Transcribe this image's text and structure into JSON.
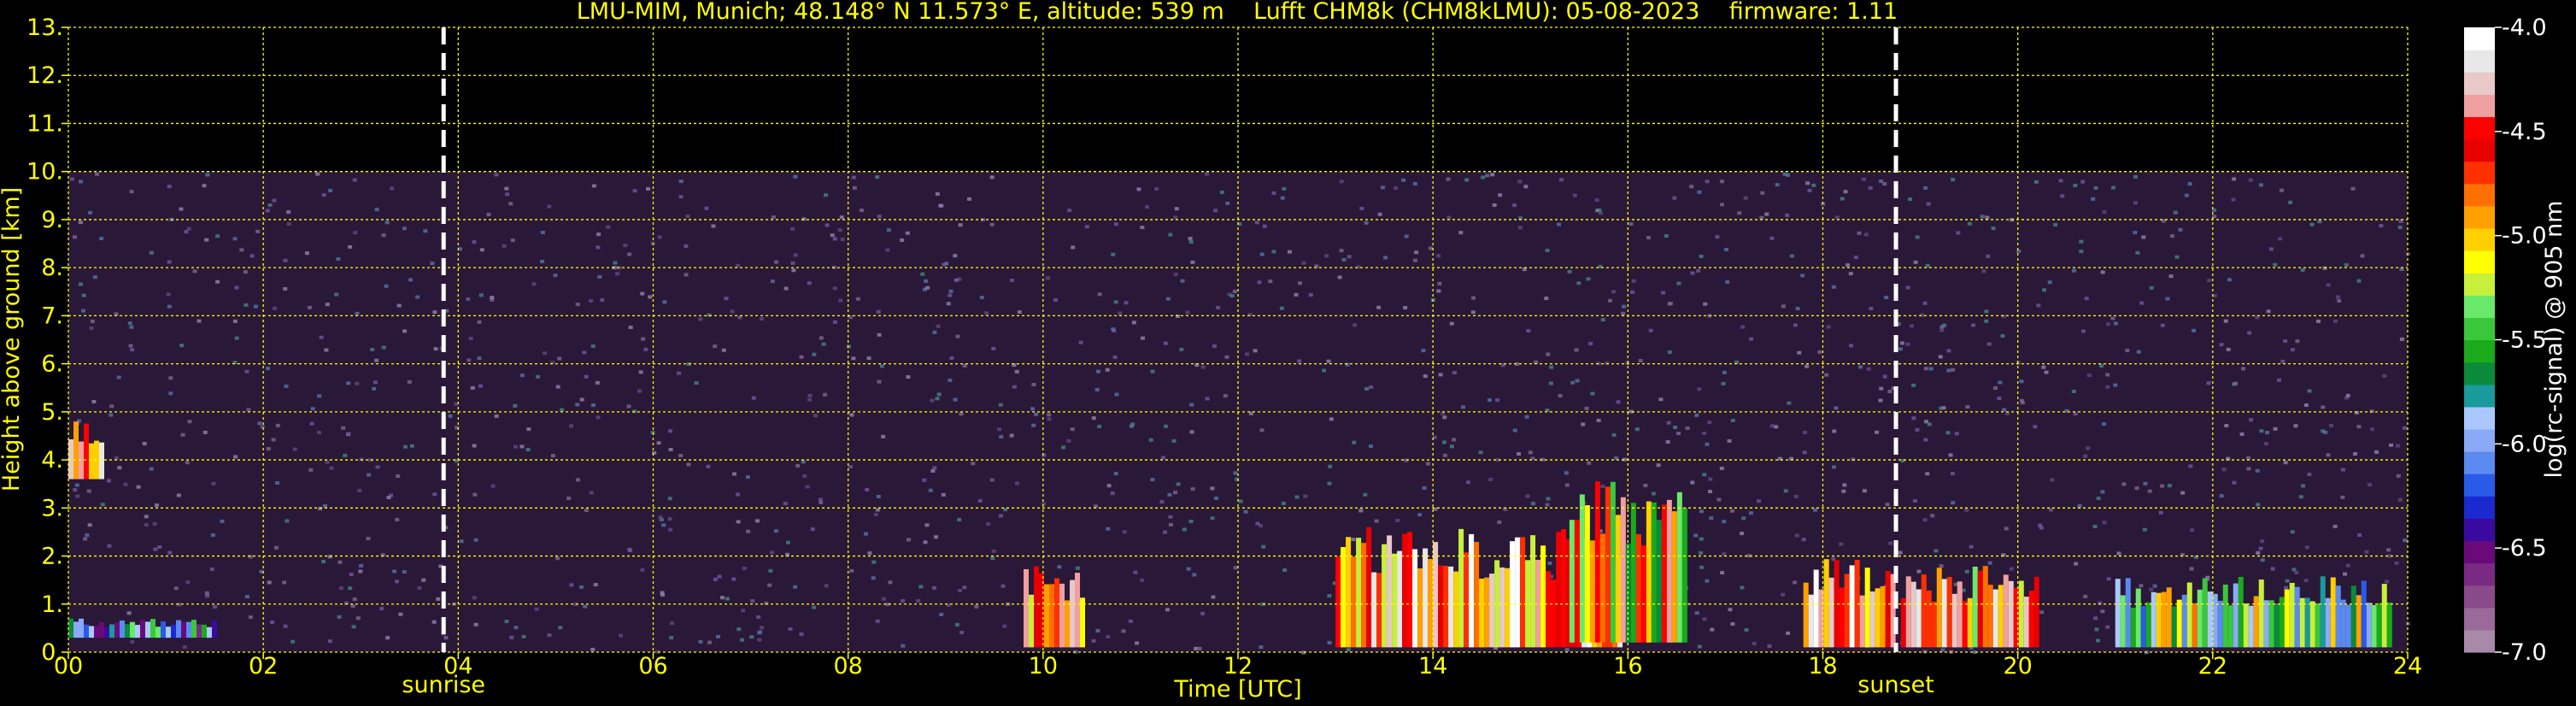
{
  "chart_data": {
    "type": "heatmap",
    "title": "LMU-MIM, Munich; 48.148° N 11.573° E, altitude: 539 m    Lufft CHM8k (CHM8kLMU): 05-08-2023    firmware: 1.11",
    "xlabel": "Time [UTC]",
    "ylabel": "Height above ground [km]",
    "xlim": [
      0,
      24
    ],
    "ylim": [
      0,
      13
    ],
    "x_ticks": [
      "00",
      "02",
      "04",
      "06",
      "08",
      "10",
      "12",
      "14",
      "16",
      "18",
      "20",
      "22",
      "24"
    ],
    "x_tick_values": [
      0,
      2,
      4,
      6,
      8,
      10,
      12,
      14,
      16,
      18,
      20,
      22,
      24
    ],
    "y_ticks": [
      "0.",
      "1.",
      "2.",
      "3.",
      "4.",
      "5.",
      "6.",
      "7.",
      "8.",
      "9.",
      "10.",
      "11.",
      "12.",
      "13."
    ],
    "y_tick_values": [
      0,
      1,
      2,
      3,
      4,
      5,
      6,
      7,
      8,
      9,
      10,
      11,
      12,
      13
    ],
    "grid": true,
    "grid_color": "#ffff00",
    "data_top_km": 10,
    "markers": [
      {
        "label": "sunrise",
        "time": 3.85
      },
      {
        "label": "sunset",
        "time": 18.75
      }
    ],
    "colorbar": {
      "label": "log(rc-signal) @ 905 nm",
      "range": [
        -7.0,
        -4.0
      ],
      "ticks": [
        "-4.0",
        "-4.5",
        "-5.0",
        "-5.5",
        "-6.0",
        "-6.5",
        "-7.0"
      ],
      "tick_values": [
        -4.0,
        -4.5,
        -5.0,
        -5.5,
        -6.0,
        -6.5,
        -7.0
      ],
      "colors_low_to_high": [
        "#a88aa8",
        "#9a6a9a",
        "#8a4a8a",
        "#7a2a82",
        "#6a0a7a",
        "#3a0aa0",
        "#1a2ad0",
        "#2a5ae8",
        "#5a8af0",
        "#8aaaf8",
        "#aac8ff",
        "#1a9a9a",
        "#0a8a3a",
        "#1aaa1a",
        "#3ac83a",
        "#6ae86a",
        "#c8f03a",
        "#ffff00",
        "#ffd000",
        "#ffa000",
        "#ff7000",
        "#ff3000",
        "#e80000",
        "#ff0000",
        "#f0a0a0",
        "#e8c8c8",
        "#e8e8e8",
        "#ffffff"
      ]
    },
    "cloud_layers": [
      {
        "start": 0.0,
        "end": 0.35,
        "base": 3.6,
        "top": 4.9,
        "level": 0.85
      },
      {
        "start": 0.0,
        "end": 1.5,
        "base": 0.3,
        "top": 0.7,
        "level": 0.35
      },
      {
        "start": 9.8,
        "end": 10.4,
        "base": 0.1,
        "top": 1.8,
        "level": 0.8
      },
      {
        "start": 13.0,
        "end": 15.9,
        "base": 0.1,
        "top": 2.6,
        "level": 0.8
      },
      {
        "start": 15.4,
        "end": 16.6,
        "base": 0.2,
        "top": 3.6,
        "level": 0.65
      },
      {
        "start": 17.8,
        "end": 18.7,
        "base": 0.1,
        "top": 2.0,
        "level": 0.85
      },
      {
        "start": 18.8,
        "end": 20.2,
        "base": 0.1,
        "top": 1.8,
        "level": 0.75
      },
      {
        "start": 21.0,
        "end": 23.8,
        "base": 0.1,
        "top": 1.6,
        "level": 0.5
      }
    ]
  }
}
